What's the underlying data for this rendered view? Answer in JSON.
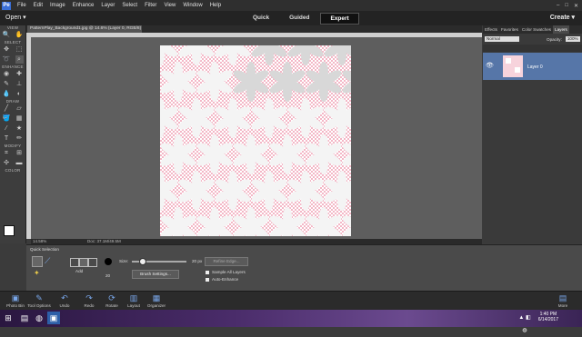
{
  "menu": {
    "logo": "Pe",
    "items": [
      "File",
      "Edit",
      "Image",
      "Enhance",
      "Layer",
      "Select",
      "Filter",
      "View",
      "Window",
      "Help"
    ],
    "minimize": "–",
    "maximize": "□",
    "close": "✕"
  },
  "modebar": {
    "open_label": "Open ▾",
    "modes": [
      "Quick",
      "Guided",
      "Expert"
    ],
    "active_mode": "Expert",
    "create_label": "Create ▾"
  },
  "toolbox": {
    "sections": [
      "VIEW",
      "SELECT",
      "ENHANCE",
      "DRAW",
      "MODIFY",
      "COLOR"
    ]
  },
  "document": {
    "tab_label": "PatternPlay_Background1.jpg @ 14.6% (Layer 0, RGB/8)",
    "status_zoom": "14.58%",
    "status_doc": "Doc: 37.1M/49.5M"
  },
  "right_panel": {
    "tabs": [
      "Effects",
      "Favorites",
      "Color Swatches",
      "Layers"
    ],
    "active_tab": "Layers",
    "blend_mode": "Normal",
    "opacity_label": "Opacity:",
    "opacity_value": "100%",
    "layer_name": "Layer 0"
  },
  "tool_options": {
    "title": "Quick Selection",
    "add_label": "Add",
    "brush_size_num": "20",
    "size_label": "Size:",
    "size_value": "20 px",
    "brush_settings": "Brush Settings...",
    "refine_edge": "Refine Edge...",
    "sample_all": "Sample All Layers",
    "auto_enhance": "Auto-Enhance"
  },
  "bottom_bar": {
    "items": [
      "Photo Bin",
      "Tool Options",
      "Undo",
      "Redo",
      "Rotate",
      "Layout",
      "Organizer"
    ],
    "more": "More"
  },
  "taskbar": {
    "time": "1:40 PM",
    "date": "6/14/2017"
  },
  "colors": {
    "layer_selected": "#5676a8",
    "pattern_pink": "#f3b7c6",
    "accent_blue": "#79a6e8"
  }
}
